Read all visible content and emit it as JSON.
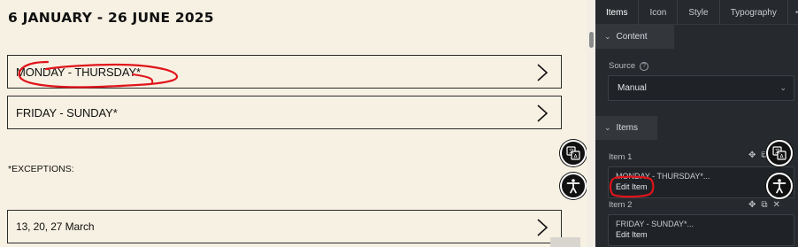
{
  "page": {
    "title": "6 JANUARY - 26 JUNE 2025",
    "accordions": [
      {
        "label": "MONDAY - THURSDAY*"
      },
      {
        "label": "FRIDAY - SUNDAY*"
      },
      {
        "label": "13, 20, 27 March"
      }
    ],
    "exceptions_label": "*EXCEPTIONS:"
  },
  "icons": {
    "chevron": "chevron-right-icon",
    "translate": "translate-icon",
    "accessibility": "accessibility-icon"
  },
  "panel": {
    "tabs": [
      {
        "label": "Items",
        "active": true
      },
      {
        "label": "Icon"
      },
      {
        "label": "Style"
      },
      {
        "label": "Typography"
      },
      {
        "label": "•••"
      }
    ],
    "content_section": {
      "label": "Content"
    },
    "source": {
      "label": "Source",
      "value": "Manual"
    },
    "items_section": {
      "label": "Items"
    },
    "items": [
      {
        "label": "Item 1",
        "title": "MONDAY - THURSDAY*...",
        "edit": "Edit Item"
      },
      {
        "label": "Item 2",
        "title": "FRIDAY - SUNDAY*...",
        "edit": "Edit Item"
      }
    ]
  },
  "colors": {
    "canvas_bg": "#f7f1e3",
    "panel_bg": "#26292d",
    "annotation": "#e0141b"
  }
}
